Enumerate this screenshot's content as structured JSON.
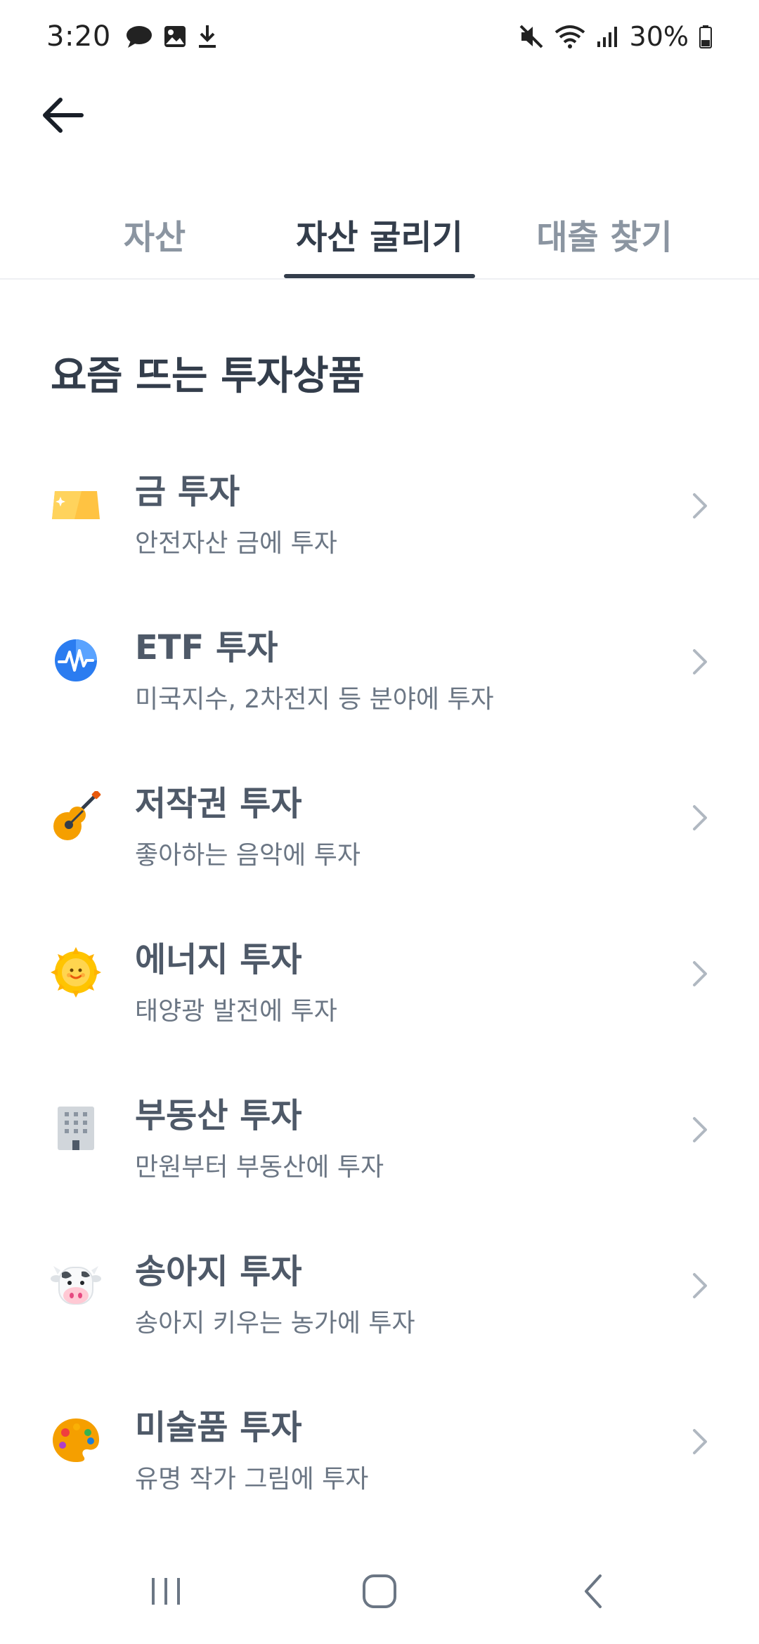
{
  "status_bar": {
    "time": "3:20",
    "battery": "30%",
    "left_icons": [
      "chat-bubble-icon",
      "image-icon",
      "download-icon"
    ],
    "right_icons": [
      "mute-icon",
      "wifi-icon",
      "signal-icon",
      "battery-icon"
    ]
  },
  "tabs": [
    {
      "label": "자산",
      "active": false
    },
    {
      "label": "자산 굴리기",
      "active": true
    },
    {
      "label": "대출 찾기",
      "active": false
    }
  ],
  "section": {
    "title": "요즘 뜨는 투자상품"
  },
  "products": [
    {
      "title": "금 투자",
      "subtitle": "안전자산 금에 투자",
      "icon": "gold-bar-icon"
    },
    {
      "title": "ETF 투자",
      "subtitle": "미국지수, 2차전지 등 분야에 투자",
      "icon": "won-pulse-icon"
    },
    {
      "title": "저작권 투자",
      "subtitle": "좋아하는 음악에 투자",
      "icon": "guitar-icon"
    },
    {
      "title": "에너지 투자",
      "subtitle": "태양광 발전에 투자",
      "icon": "sun-icon"
    },
    {
      "title": "부동산 투자",
      "subtitle": "만원부터 부동산에 투자",
      "icon": "building-icon"
    },
    {
      "title": "송아지 투자",
      "subtitle": "송아지 키우는 농가에 투자",
      "icon": "cow-icon"
    },
    {
      "title": "미술품 투자",
      "subtitle": "유명 작가 그림에 투자",
      "icon": "palette-icon"
    }
  ],
  "colors": {
    "text_primary": "#333d4b",
    "text_secondary": "#6b7684",
    "tab_inactive": "#8b95a1",
    "chevron": "#b0b8c1"
  }
}
